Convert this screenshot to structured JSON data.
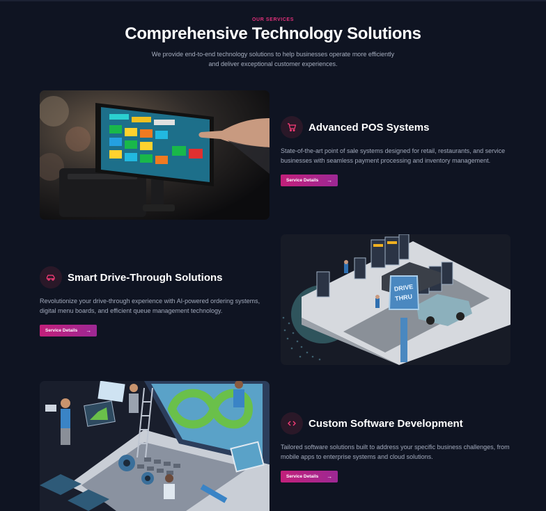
{
  "header": {
    "eyebrow": "OUR SERVICES",
    "title": "Comprehensive Technology Solutions",
    "subtitle": "We provide end-to-end technology solutions to help businesses operate more efficiently and deliver exceptional customer experiences."
  },
  "services": [
    {
      "icon": "cart-icon",
      "title": "Advanced POS Systems",
      "description": "State-of-the-art point of sale systems designed for retail, restaurants, and service businesses with seamless payment processing and inventory management.",
      "button": "Service Details"
    },
    {
      "icon": "car-icon",
      "title": "Smart Drive-Through Solutions",
      "description": "Revolutionize your drive-through experience with AI-powered ordering systems, digital menu boards, and efficient queue management technology.",
      "button": "Service Details"
    },
    {
      "icon": "code-icon",
      "title": "Custom Software Development",
      "description": "Tailored software solutions built to address your specific business challenges, from mobile apps to enterprise systems and cloud solutions.",
      "button": "Service Details"
    }
  ],
  "illustrations": {
    "drive_thru_sign": "DRIVE THRU"
  },
  "colors": {
    "accent": "#e0307a",
    "background": "#0f1422",
    "button_gradient_start": "#c2207a",
    "button_gradient_end": "#9d2894"
  }
}
